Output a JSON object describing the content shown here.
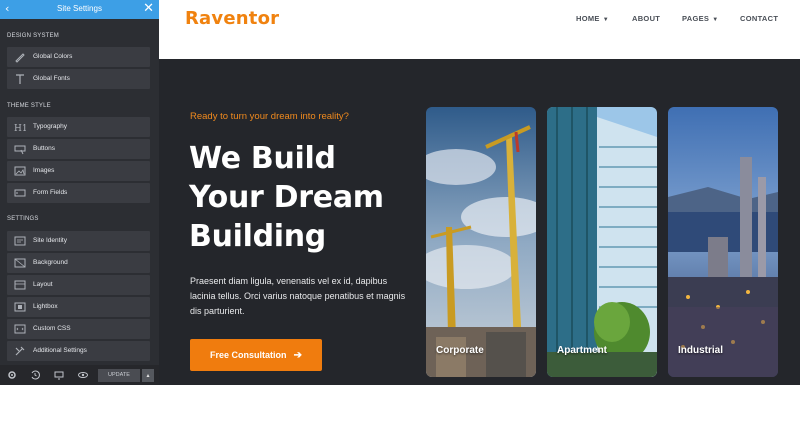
{
  "sidebar": {
    "title": "Site Settings",
    "sections": [
      {
        "heading": "DESIGN SYSTEM",
        "items": [
          {
            "label": "Global Colors",
            "icon": "brush-icon"
          },
          {
            "label": "Global Fonts",
            "icon": "font-icon"
          }
        ]
      },
      {
        "heading": "THEME STYLE",
        "items": [
          {
            "label": "Typography",
            "icon": "heading-icon"
          },
          {
            "label": "Buttons",
            "icon": "button-icon"
          },
          {
            "label": "Images",
            "icon": "image-icon"
          },
          {
            "label": "Form Fields",
            "icon": "form-icon"
          }
        ]
      },
      {
        "heading": "SETTINGS",
        "items": [
          {
            "label": "Site Identity",
            "icon": "identity-icon"
          },
          {
            "label": "Background",
            "icon": "background-icon"
          },
          {
            "label": "Layout",
            "icon": "layout-icon"
          },
          {
            "label": "Lightbox",
            "icon": "lightbox-icon"
          },
          {
            "label": "Custom CSS",
            "icon": "code-icon"
          },
          {
            "label": "Additional Settings",
            "icon": "tools-icon"
          }
        ]
      }
    ],
    "footer": {
      "update_label": "UPDATE"
    }
  },
  "site": {
    "logo": "Raventor",
    "nav": [
      {
        "label": "HOME",
        "dropdown": true
      },
      {
        "label": "ABOUT",
        "dropdown": false
      },
      {
        "label": "PAGES",
        "dropdown": true
      },
      {
        "label": "CONTACT",
        "dropdown": false
      }
    ]
  },
  "hero": {
    "tagline": "Ready to turn your dream into reality?",
    "headline": [
      "We Build",
      "Your Dream",
      "Building"
    ],
    "description": "Praesent diam ligula, venenatis vel ex id, dapibus lacinia tellus. Orci varius natoque penatibus et magnis dis parturient.",
    "cta_label": "Free Consultation",
    "cards": [
      {
        "label": "Corporate"
      },
      {
        "label": "Apartment"
      },
      {
        "label": "Industrial"
      }
    ]
  },
  "colors": {
    "accent": "#f07c0e",
    "sidebar_header": "#3d9fe6",
    "hero_bg": "#24262b"
  }
}
